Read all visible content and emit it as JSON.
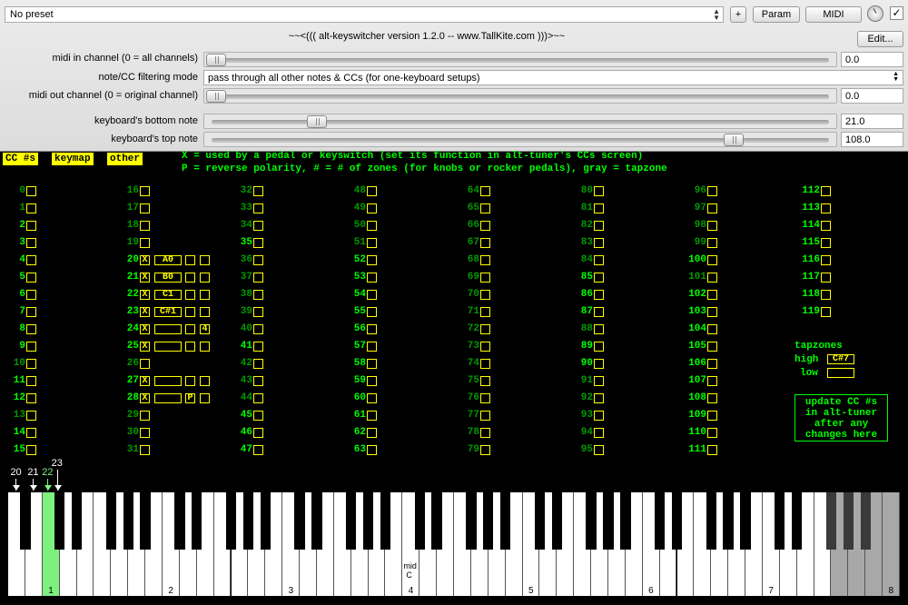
{
  "header": {
    "preset": "No preset",
    "plus": "+",
    "param": "Param",
    "midi": "MIDI",
    "check": "✓",
    "title": "~~<(((   alt-keyswitcher version 1.2.0 -- www.TallKite.com   )))>~~",
    "edit": "Edit..."
  },
  "params": {
    "midi_in_label": "midi in channel (0 = all channels)",
    "midi_in_value": "0.0",
    "midi_in_level": 0,
    "filter_label": "note/CC filtering mode",
    "filter_value": "pass through all other notes & CCs (for one-keyboard setups)",
    "midi_out_label": "midi out channel (0 = original channel)",
    "midi_out_value": "0.0",
    "midi_out_level": 0,
    "bottom_label": "keyboard's bottom note",
    "bottom_value": "21.0",
    "bottom_level": 0.165,
    "top_label": "keyboard's top note",
    "top_value": "108.0",
    "top_level": 0.85
  },
  "tabs": {
    "cc": "CC #s",
    "keymap": "keymap",
    "other": "other"
  },
  "info": {
    "line1": "X = used by a pedal or keyswitch (set its function in alt-tuner's CCs screen)",
    "line2": "P = reverse polarity, # = # of zones (for knobs or rocker pedals), gray = tapzone"
  },
  "cc": {
    "bright": [
      2,
      3,
      4,
      5,
      6,
      7,
      8,
      9,
      11,
      12,
      14,
      15,
      20,
      21,
      22,
      23,
      24,
      25,
      27,
      28,
      35,
      41,
      45,
      46,
      47,
      52,
      53,
      54,
      55,
      56,
      57,
      58,
      59,
      60,
      61,
      62,
      63,
      85,
      86,
      87,
      89,
      90,
      100,
      102,
      103,
      104,
      105,
      106,
      107,
      108,
      109,
      110,
      111,
      112,
      113,
      114,
      115,
      116,
      117,
      118,
      119
    ],
    "rows": {
      "20": [
        "X",
        "A0",
        "",
        ""
      ],
      "21": [
        "X",
        "B0",
        "",
        ""
      ],
      "22": [
        "X",
        "C1",
        "",
        ""
      ],
      "23": [
        "X",
        "C#1",
        "",
        ""
      ],
      "24": [
        "X",
        "",
        "",
        "4"
      ],
      "25": [
        "X",
        "",
        "",
        ""
      ],
      "27": [
        "X",
        "",
        "",
        ""
      ],
      "28": [
        "X",
        "",
        "P",
        ""
      ]
    }
  },
  "tapzones": {
    "title": "tapzones",
    "high_label": "high",
    "high_value": "C#7",
    "low_label": "low",
    "low_value": ""
  },
  "update": {
    "text": "update CC #s\nin alt-tuner\nafter any\nchanges here"
  },
  "keyboard": {
    "markers": [
      "20",
      "21",
      "22",
      "23"
    ],
    "mid": "mid",
    "midc": "C",
    "octaves": [
      "1",
      "2",
      "3",
      "4",
      "5",
      "6",
      "7",
      "8"
    ]
  }
}
